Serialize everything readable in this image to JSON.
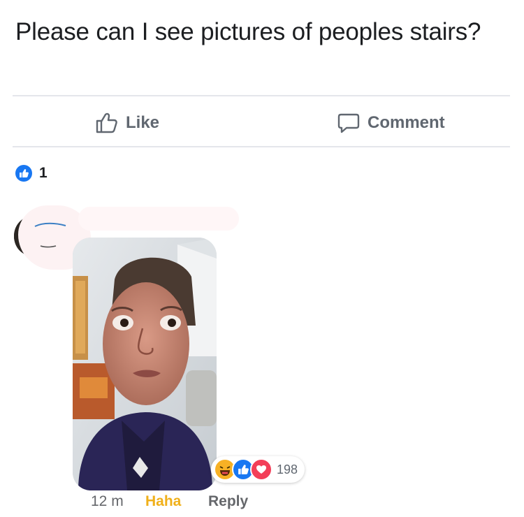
{
  "post": {
    "text": "Please can I see pictures of peoples stairs?"
  },
  "actions": {
    "like_label": "Like",
    "comment_label": "Comment"
  },
  "like_summary": {
    "count": "1"
  },
  "comment": {
    "reactions": [
      "haha-icon",
      "like-icon",
      "love-icon"
    ],
    "reaction_count": "198",
    "time": "12 m",
    "reaction_label": "Haha",
    "reply_label": "Reply"
  },
  "colors": {
    "like_blue": "#1877f2",
    "love_red": "#f33e58",
    "haha_yellow": "#f7b125",
    "muted_text": "#65676b"
  }
}
